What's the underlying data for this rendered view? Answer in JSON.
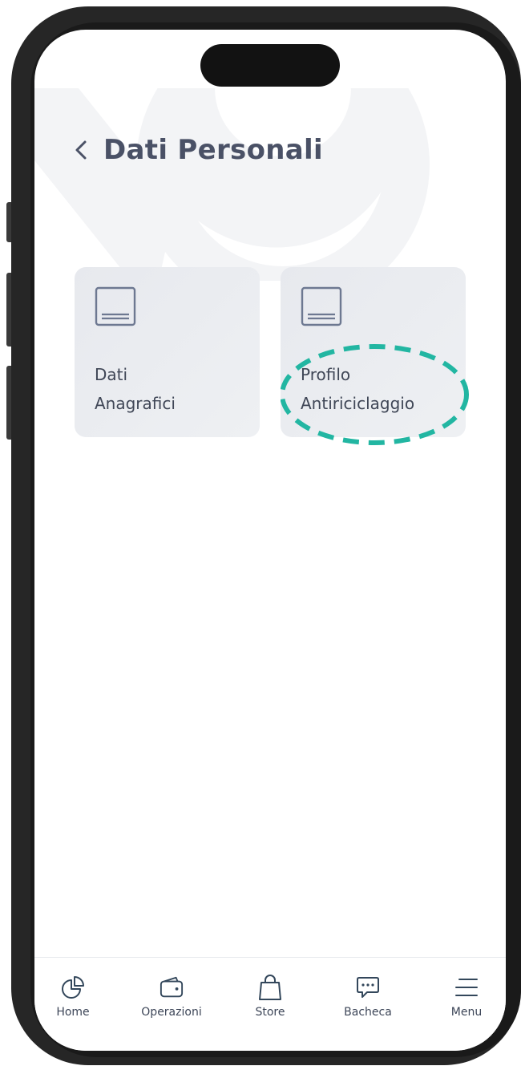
{
  "header": {
    "back_icon": "chevron-left-icon",
    "title": "Dati Personali"
  },
  "cards": [
    {
      "icon": "document-icon",
      "line1": "Dati",
      "line2": "Anagrafici"
    },
    {
      "icon": "document-icon",
      "line1": "Profilo",
      "line2": "Antiriciclaggio",
      "highlighted": true
    }
  ],
  "tabbar": {
    "items": [
      {
        "label": "Home",
        "icon": "pie-chart-icon"
      },
      {
        "label": "Operazioni",
        "icon": "wallet-icon"
      },
      {
        "label": "Store",
        "icon": "shopping-bag-icon"
      },
      {
        "label": "Bacheca",
        "icon": "chat-bubble-icon"
      },
      {
        "label": "Menu",
        "icon": "menu-icon"
      }
    ]
  },
  "colors": {
    "title": "#4a5166",
    "card_bg": "#e8eaee",
    "highlight": "#22b6a2",
    "tab_icon": "#33475b"
  }
}
